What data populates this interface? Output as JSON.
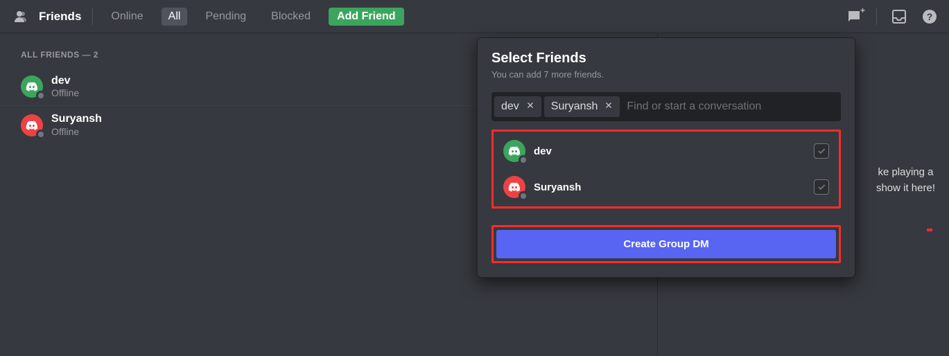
{
  "toolbar": {
    "title": "Friends",
    "tabs": {
      "online": "Online",
      "all": "All",
      "pending": "Pending",
      "blocked": "Blocked"
    },
    "add_friend": "Add Friend",
    "icons": {
      "friends": "friends-icon",
      "new_dm": "new-group-dm-icon",
      "inbox": "inbox-icon",
      "help": "help-icon"
    }
  },
  "friends_list": {
    "header": "ALL FRIENDS — 2",
    "items": [
      {
        "name": "dev",
        "status": "Offline",
        "avatar_color": "#3ba55d"
      },
      {
        "name": "Suryansh",
        "status": "Offline",
        "avatar_color": "#ed4245"
      }
    ]
  },
  "activity": {
    "hint_line1": "ke playing a",
    "hint_line2": "show it here!"
  },
  "popout": {
    "title": "Select Friends",
    "subtitle": "You can add 7 more friends.",
    "search_placeholder": "Find or start a conversation",
    "chips": [
      "dev",
      "Suryansh"
    ],
    "candidates": [
      {
        "name": "dev",
        "avatar_color": "#3ba55d",
        "checked": true
      },
      {
        "name": "Suryansh",
        "avatar_color": "#ed4245",
        "checked": true
      }
    ],
    "create_label": "Create Group DM"
  }
}
